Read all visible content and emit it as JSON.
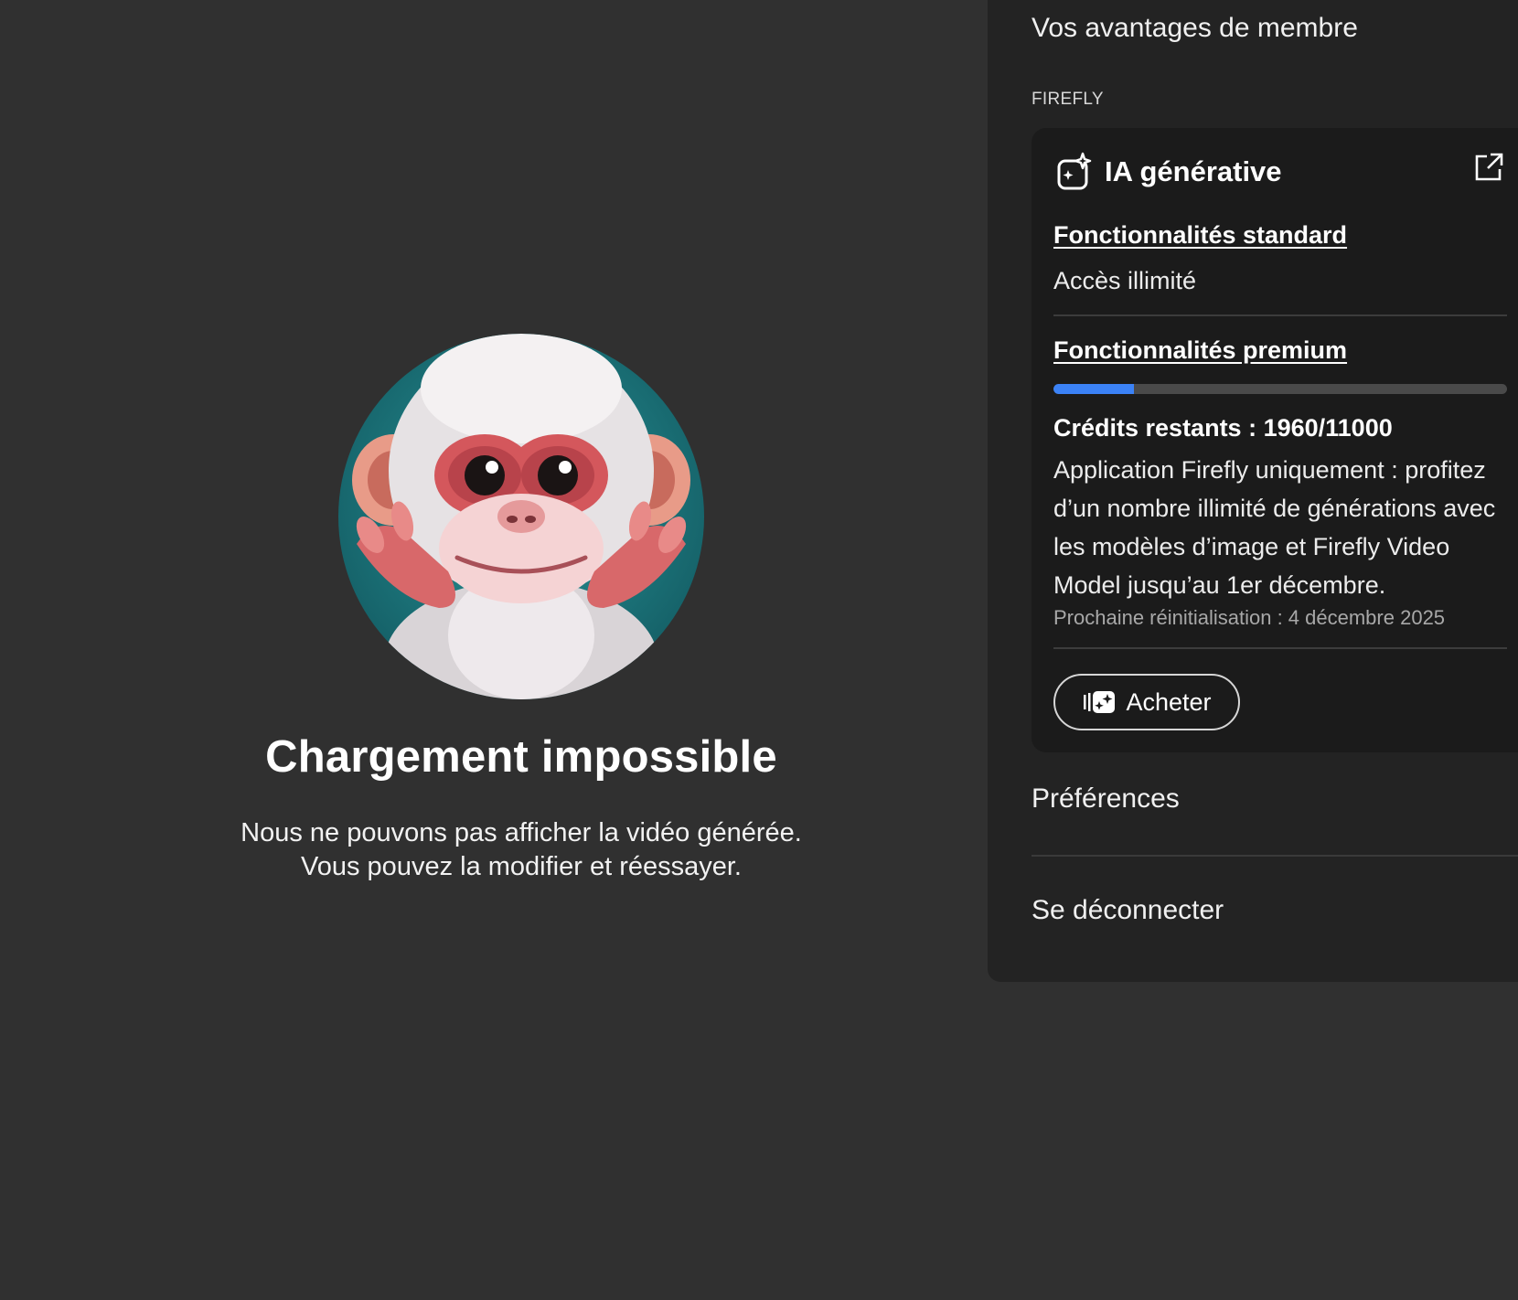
{
  "error": {
    "title": "Chargement impossible",
    "message_line1": "Nous ne pouvons pas afficher la vidéo générée.",
    "message_line2": "Vous pouvez la modifier et réessayer."
  },
  "panel": {
    "title": "Vos avantages de membre",
    "section_label": "FIREFLY",
    "card": {
      "title": "IA générative",
      "standard_link": "Fonctionnalités standard",
      "standard_value": "Accès illimité",
      "premium_link": "Fonctionnalités premium",
      "progress_fraction": 0.178,
      "credits_label": "Crédits restants : 1960/11000",
      "credits_description": "Application Firefly uniquement : profitez d’un nombre illimité de générations avec les modèles d’image et Firefly Video Model jusqu’au 1er décembre.",
      "reset_note": "Prochaine réinitialisation : 4 décembre 2025",
      "buy_label": "Acheter"
    },
    "menu": {
      "preferences": "Préférences",
      "logout": "Se déconnecter"
    }
  },
  "icons": {
    "generative": "generative-ai-icon",
    "external": "external-link-icon",
    "buy": "credits-icon"
  },
  "colors": {
    "background": "#303030",
    "panel": "#232323",
    "card": "#1b1b1b",
    "accent": "#3b82f6"
  }
}
